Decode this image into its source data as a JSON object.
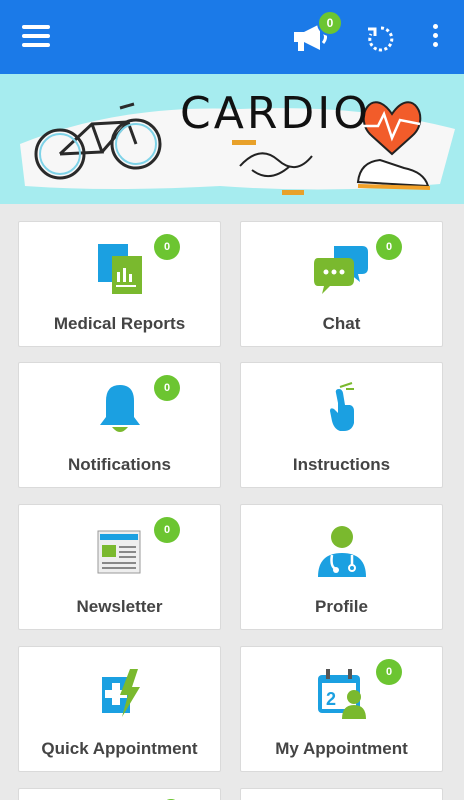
{
  "appbar": {
    "announcements_badge": "0"
  },
  "banner": {
    "title": "CARDIO"
  },
  "tiles": [
    {
      "label": "Medical Reports",
      "badge": "0"
    },
    {
      "label": "Chat",
      "badge": "0"
    },
    {
      "label": "Notifications",
      "badge": "0"
    },
    {
      "label": "Instructions"
    },
    {
      "label": "Newsletter",
      "badge": "0"
    },
    {
      "label": "Profile"
    },
    {
      "label": "Quick Appointment"
    },
    {
      "label": "My Appointment",
      "badge": "0"
    }
  ],
  "colors": {
    "appbar": "#1b7ae8",
    "banner_bg": "#a6ecef",
    "badge": "#6cc531",
    "icon_blue": "#1ba0e1",
    "icon_green": "#7ab92e"
  },
  "icons": {
    "menu": "hamburger-menu-icon",
    "announcements": "megaphone-icon",
    "refresh": "refresh-icon",
    "overflow": "more-vertical-icon"
  }
}
